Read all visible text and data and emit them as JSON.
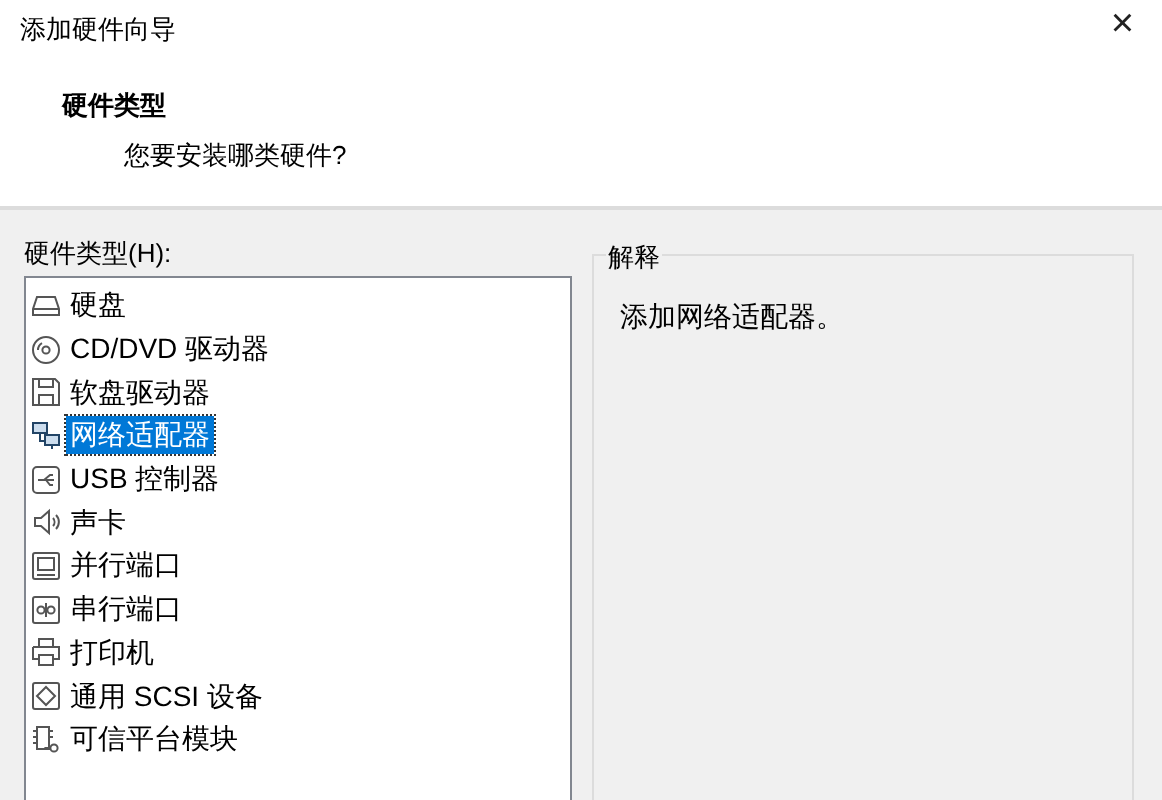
{
  "window": {
    "title": "添加硬件向导",
    "close": "×"
  },
  "header": {
    "title": "硬件类型",
    "subtitle": "您要安装哪类硬件?"
  },
  "hardware_list": {
    "label": "硬件类型(H):",
    "items": [
      {
        "kind": "disk",
        "label": "硬盘",
        "selected": false
      },
      {
        "kind": "cd",
        "label": "CD/DVD 驱动器",
        "selected": false
      },
      {
        "kind": "floppy",
        "label": "软盘驱动器",
        "selected": false
      },
      {
        "kind": "network",
        "label": "网络适配器",
        "selected": true
      },
      {
        "kind": "usb",
        "label": "USB 控制器",
        "selected": false
      },
      {
        "kind": "sound",
        "label": "声卡",
        "selected": false
      },
      {
        "kind": "parallel",
        "label": "并行端口",
        "selected": false
      },
      {
        "kind": "serial",
        "label": "串行端口",
        "selected": false
      },
      {
        "kind": "printer",
        "label": "打印机",
        "selected": false
      },
      {
        "kind": "scsi",
        "label": "通用 SCSI 设备",
        "selected": false
      },
      {
        "kind": "tpm",
        "label": "可信平台模块",
        "selected": false
      }
    ]
  },
  "explanation": {
    "legend": "解释",
    "text": "添加网络适配器。"
  }
}
